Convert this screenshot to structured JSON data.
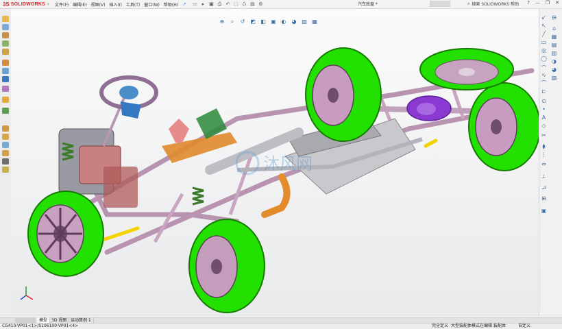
{
  "app": {
    "brand": "SOLIDWORKS",
    "brand_prefix": "3S",
    "document_title": "汽车底盘 *",
    "search_text": "搜索 SOLIDWORKS 帮助"
  },
  "menu": [
    {
      "label": "文件(F)"
    },
    {
      "label": "编辑(E)"
    },
    {
      "label": "视图(V)"
    },
    {
      "label": "插入(I)"
    },
    {
      "label": "工具(T)"
    },
    {
      "label": "窗口(W)"
    },
    {
      "label": "帮助(H)"
    }
  ],
  "window_controls": {
    "minimize": "—",
    "restore": "❐",
    "close": "✕",
    "help": "?"
  },
  "tabs": [
    {
      "label": "模型",
      "active": true
    },
    {
      "label": "3D 视图",
      "active": false
    },
    {
      "label": "运动算例 1",
      "active": false
    }
  ],
  "status": {
    "path": "CG410-VP01<1>/S106100-VP01<4>",
    "mode1": "完全定义",
    "mode2": "大型装配体模式",
    "mode3": "在编辑 装配体",
    "units": "自定义"
  },
  "watermark": "沐风网",
  "colors": {
    "wheel": "#22e000",
    "frame": "#c8a8c0",
    "axle": "#8a3ad0",
    "yellow": "#f4d200",
    "orange": "#e38a2a",
    "steering": "#4a8cc8"
  }
}
